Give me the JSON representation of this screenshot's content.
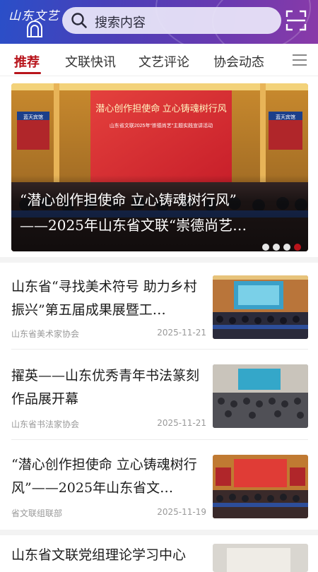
{
  "header": {
    "logo_text": "山东文艺",
    "search_placeholder": "搜索内容"
  },
  "tabs": [
    {
      "label": "推荐",
      "active": true
    },
    {
      "label": "文联快讯",
      "active": false
    },
    {
      "label": "文艺评论",
      "active": false
    },
    {
      "label": "协会动态",
      "active": false
    }
  ],
  "banner": {
    "caption_line1": "“潜心创作担使命 立心铸魂树行风”",
    "caption_line2": "——2025年山东省文联“崇德尚艺…",
    "stage_title": "潜心创作担使命  立心铸魂树行风",
    "stage_subtitle": "山东省文联2025年“崇德尚艺”主题实践宣讲活动",
    "side_sign": "蓝天宾馆",
    "slide_count": 4,
    "active_slide": 4
  },
  "news": [
    {
      "title": "山东省“寻找美术符号 助力乡村振兴”第五届成果展暨工…",
      "source": "山东省美术家协会",
      "date": "2025-11-21"
    },
    {
      "title": "擢英——山东优秀青年书法篆刻作品展开幕",
      "source": "山东省书法家协会",
      "date": "2025-11-21"
    },
    {
      "title": "“潜心创作担使命 立心铸魂树行风”——2025年山东省文…",
      "source": "省文联组联部",
      "date": "2025-11-19"
    },
    {
      "title": "山东省文联党组理论学习中心",
      "source": "",
      "date": ""
    }
  ],
  "colors": {
    "accent": "#b8141b",
    "header_start": "#2a4fc8",
    "header_end": "#8a3aa8"
  }
}
